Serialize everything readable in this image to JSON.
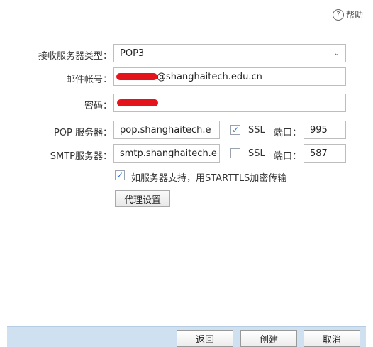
{
  "header": {
    "help_label": "帮助",
    "help_icon": "question-circle-icon"
  },
  "form": {
    "server_type_label": "接收服务器类型：",
    "server_type_value": "POP3",
    "email_label": "邮件帐号：",
    "email_value_suffix": "@shanghaitech.edu.cn",
    "password_label": "密码：",
    "pop_label": "POP 服务器：",
    "pop_value": "pop.shanghaitech.e",
    "pop_ssl_checked": true,
    "pop_ssl_label": "SSL",
    "pop_port_label": "端口：",
    "pop_port_value": "995",
    "smtp_label": "SMTP服务器：",
    "smtp_value": "smtp.shanghaitech.e",
    "smtp_ssl_checked": false,
    "smtp_ssl_label": "SSL",
    "smtp_port_label": "端口：",
    "smtp_port_value": "587",
    "starttls_checked": true,
    "starttls_label": "如服务器支持，用STARTTLS加密传输",
    "proxy_button": "代理设置"
  },
  "footer": {
    "back": "返回",
    "create": "创建",
    "cancel": "取消"
  },
  "colors": {
    "footer_bg": "#cfe0f1",
    "redaction": "#e3141c",
    "check": "#1b66c9"
  }
}
